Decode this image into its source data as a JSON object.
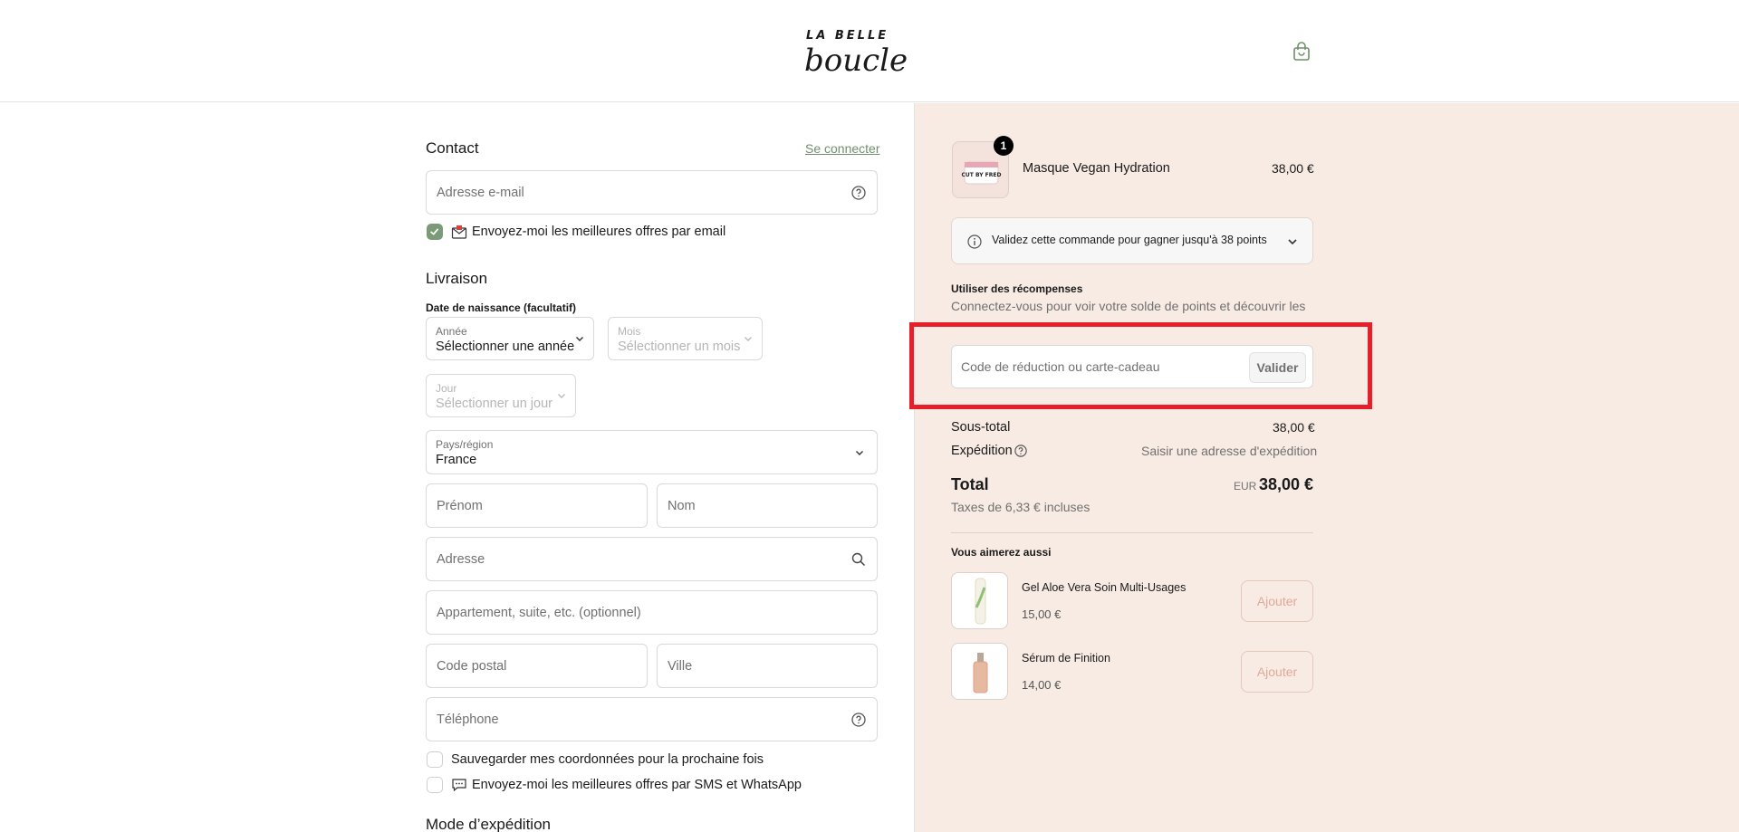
{
  "header": {
    "logo_small": "LA BELLE",
    "logo_script": "boucle"
  },
  "contact": {
    "title": "Contact",
    "login_link": "Se connecter",
    "email_placeholder": "Adresse e-mail",
    "newsletter_label": "Envoyez-moi les meilleures offres par email",
    "newsletter_checked": true
  },
  "delivery": {
    "title": "Livraison",
    "dob_label": "Date de naissance (facultatif)",
    "year_label": "Année",
    "year_value": "Sélectionner une année",
    "month_label": "Mois",
    "month_value": "Sélectionner un mois",
    "day_label": "Jour",
    "day_value": "Sélectionner un jour",
    "country_label": "Pays/région",
    "country_value": "France",
    "first_name_placeholder": "Prénom",
    "last_name_placeholder": "Nom",
    "address_placeholder": "Adresse",
    "apartment_placeholder": "Appartement, suite, etc. (optionnel)",
    "postal_placeholder": "Code postal",
    "city_placeholder": "Ville",
    "phone_placeholder": "Téléphone",
    "save_info_label": "Sauvegarder mes coordonnées pour la prochaine fois",
    "sms_label": "Envoyez-moi les meilleures offres par SMS et WhatsApp"
  },
  "shipping_method": {
    "title": "Mode d’expédition"
  },
  "summary": {
    "product": {
      "name": "Masque Vegan Hydration",
      "price": "38,00 €",
      "quantity": "1",
      "thumb_text": "CUT BY FRED"
    },
    "loyalty_text": "Validez cette commande pour gagner jusqu'à 38 points",
    "rewards_title": "Utiliser des récompenses",
    "rewards_text": "Connectez-vous pour voir votre solde de points et découvrir les",
    "discount_placeholder": "Code de réduction ou carte-cadeau",
    "apply_label": "Valider",
    "subtotal_label": "Sous-total",
    "subtotal_value": "38,00 €",
    "shipping_label": "Expédition",
    "shipping_value": "Saisir une adresse d'expédition",
    "total_label": "Total",
    "currency": "EUR",
    "total_value": "38,00 €",
    "taxes": "Taxes de 6,33 € incluses"
  },
  "upsell": {
    "title": "Vous aimerez aussi",
    "items": [
      {
        "name": "Gel Aloe Vera Soin Multi-Usages",
        "price": "15,00 €",
        "button": "Ajouter"
      },
      {
        "name": "Sérum de Finition",
        "price": "14,00 €",
        "button": "Ajouter"
      }
    ]
  },
  "colors": {
    "accent_green": "#7b9a78",
    "summary_bg": "#f8ebe4",
    "highlight_red": "#e5202b"
  }
}
